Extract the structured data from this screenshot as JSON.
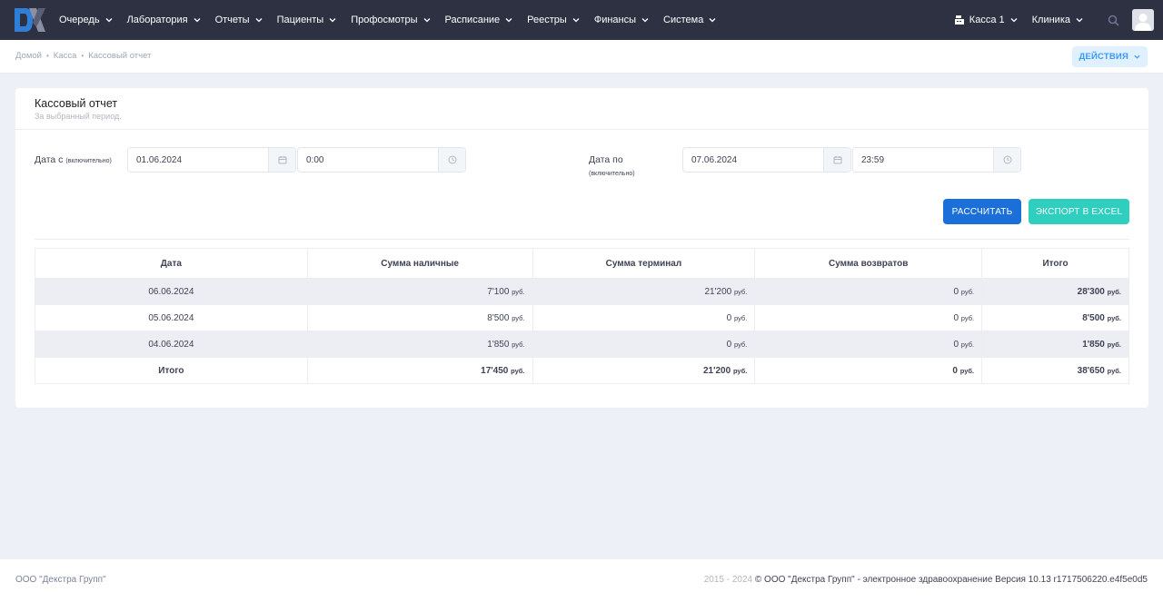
{
  "nav": {
    "items": [
      {
        "label": "Очередь"
      },
      {
        "label": "Лаборатория"
      },
      {
        "label": "Отчеты"
      },
      {
        "label": "Пациенты"
      },
      {
        "label": "Профосмотры"
      },
      {
        "label": "Расписание"
      },
      {
        "label": "Реестры"
      },
      {
        "label": "Финансы"
      },
      {
        "label": "Система"
      }
    ],
    "cash_register": "Касса 1",
    "clinic": "Клиника"
  },
  "breadcrumb": [
    "Домой",
    "Касса",
    "Кассовый отчет"
  ],
  "actions_label": "ДЕЙСТВИЯ",
  "card": {
    "title": "Кассовый отчет",
    "subtitle": "За выбранный период."
  },
  "form": {
    "date_from_label": "Дата с",
    "date_from_note": "(включительно)",
    "date_from_value": "01.06.2024",
    "time_from_value": "0:00",
    "date_to_label": "Дата по",
    "date_to_note": "(включительно)",
    "date_to_value": "07.06.2024",
    "time_to_value": "23:59",
    "calculate_label": "РАССЧИТАТЬ",
    "export_label": "ЭКСПОРТ В EXCEL"
  },
  "table": {
    "headers": [
      "Дата",
      "Сумма наличные",
      "Сумма терминал",
      "Сумма возвратов",
      "Итого"
    ],
    "currency": "руб.",
    "rows": [
      {
        "date": "06.06.2024",
        "cash": "7'100",
        "terminal": "21'200",
        "refunds": "0",
        "total": "28'300"
      },
      {
        "date": "05.06.2024",
        "cash": "8'500",
        "terminal": "0",
        "refunds": "0",
        "total": "8'500"
      },
      {
        "date": "04.06.2024",
        "cash": "1'850",
        "terminal": "0",
        "refunds": "0",
        "total": "1'850"
      }
    ],
    "totals": {
      "label": "Итого",
      "cash": "17'450",
      "terminal": "21'200",
      "refunds": "0",
      "total": "38'650"
    }
  },
  "footer": {
    "company": "ООО \"Декстра Групп\"",
    "years": "2015 - 2024",
    "copyright": "© ООО \"Декстра Групп\" - электронное здравоохранение Версия 10.13 r1717506220.e4f5e0d5"
  }
}
